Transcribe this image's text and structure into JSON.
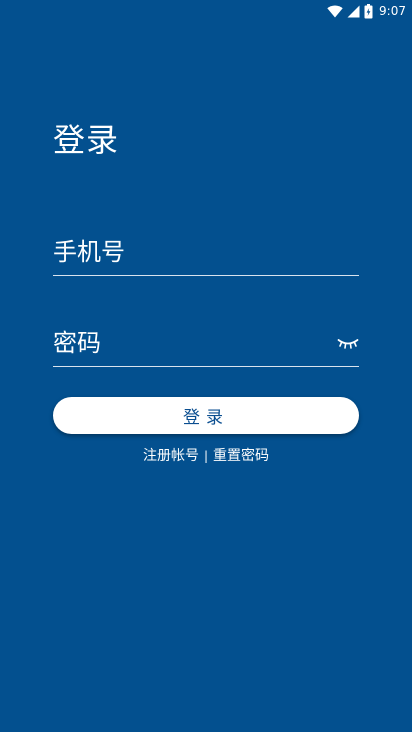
{
  "status_bar": {
    "time": "9:07",
    "icons": [
      "wifi-icon",
      "cell-signal-icon",
      "battery-icon"
    ]
  },
  "login": {
    "title": "登录",
    "phone_placeholder": "手机号",
    "password_placeholder": "密码",
    "password_toggle_icon": "eye-closed-icon",
    "button_label": "登录"
  },
  "links": {
    "register": "注册帐号",
    "separator": "|",
    "reset_password": "重置密码"
  },
  "colors": {
    "background": "#03508f",
    "button_text": "#0a4e90",
    "text": "#ffffff"
  }
}
